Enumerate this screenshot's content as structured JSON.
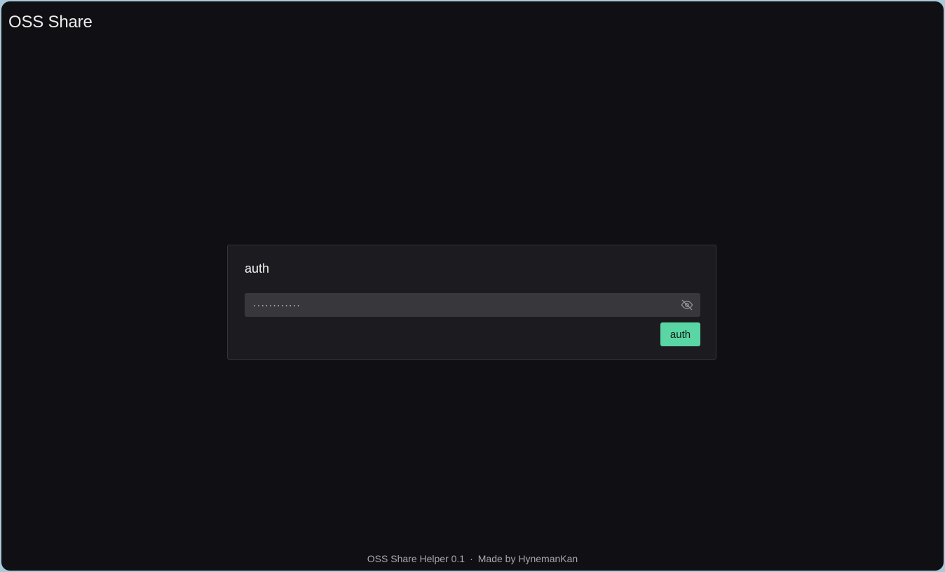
{
  "app": {
    "title": "OSS Share"
  },
  "auth_card": {
    "title": "auth",
    "password_value": "············",
    "password_placeholder": "",
    "toggle_icon": "eye-off-icon",
    "submit_label": "auth"
  },
  "footer": {
    "version_text": "OSS Share Helper 0.1",
    "separator": "·",
    "credit_text": "Made by HynemanKan"
  },
  "colors": {
    "background": "#101014",
    "card": "#1c1c20",
    "input": "#38383c",
    "accent": "#5ad5a4",
    "frame": "#a9c8d8"
  }
}
